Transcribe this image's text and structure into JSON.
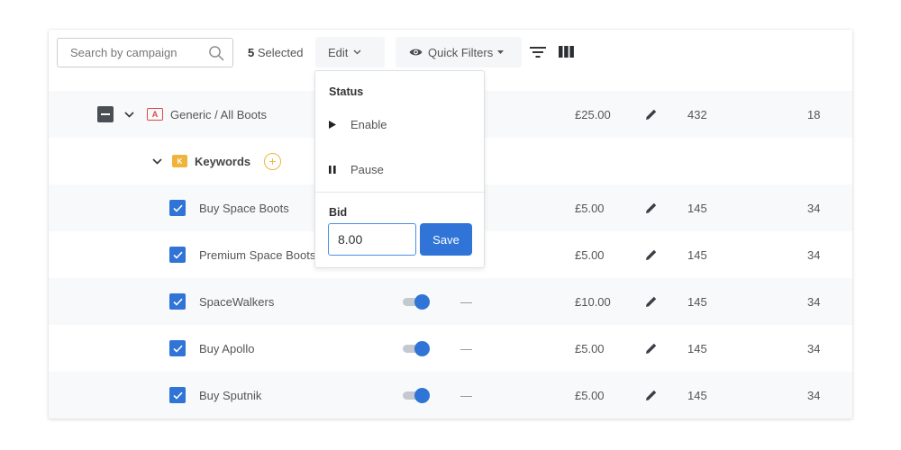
{
  "toolbar": {
    "search_placeholder": "Search by campaign",
    "selected_count": "5",
    "selected_label": " Selected",
    "edit_label": "Edit",
    "quick_filters_label": "Quick Filters"
  },
  "campaign": {
    "badge": "A",
    "name": "Generic / All Boots",
    "bid": "£25.00",
    "col_a": "432",
    "col_b": "18"
  },
  "keyword_group": {
    "badge": "K",
    "label": "Keywords",
    "add_symbol": "+"
  },
  "rows": [
    {
      "name": "Buy Space Boots",
      "bid": "£5.00",
      "col_a": "145",
      "col_b": "34",
      "status_dash": ""
    },
    {
      "name": "Premium Space Boots",
      "bid": "£5.00",
      "col_a": "145",
      "col_b": "34",
      "status_dash": ""
    },
    {
      "name": "SpaceWalkers",
      "bid": "£10.00",
      "col_a": "145",
      "col_b": "34",
      "status_dash": "—"
    },
    {
      "name": "Buy Apollo",
      "bid": "£5.00",
      "col_a": "145",
      "col_b": "34",
      "status_dash": "—"
    },
    {
      "name": "Buy Sputnik",
      "bid": "£5.00",
      "col_a": "145",
      "col_b": "34",
      "status_dash": "—"
    }
  ],
  "dropdown": {
    "status_heading": "Status",
    "enable_label": "Enable",
    "pause_label": "Pause",
    "bid_heading": "Bid",
    "bid_value": "8.00",
    "save_label": "Save"
  },
  "colors": {
    "accent": "#2f74d6",
    "campaign_badge": "#e0484c",
    "keyword_badge": "#f0b43b"
  },
  "icons": {
    "search": "search-icon",
    "edit_caret": "chevron-down-icon",
    "quick_filters": "eye-icon",
    "filter": "filter-icon",
    "columns": "columns-icon",
    "row_edit": "pencil-icon",
    "enable": "play-icon",
    "pause": "pause-icon"
  }
}
